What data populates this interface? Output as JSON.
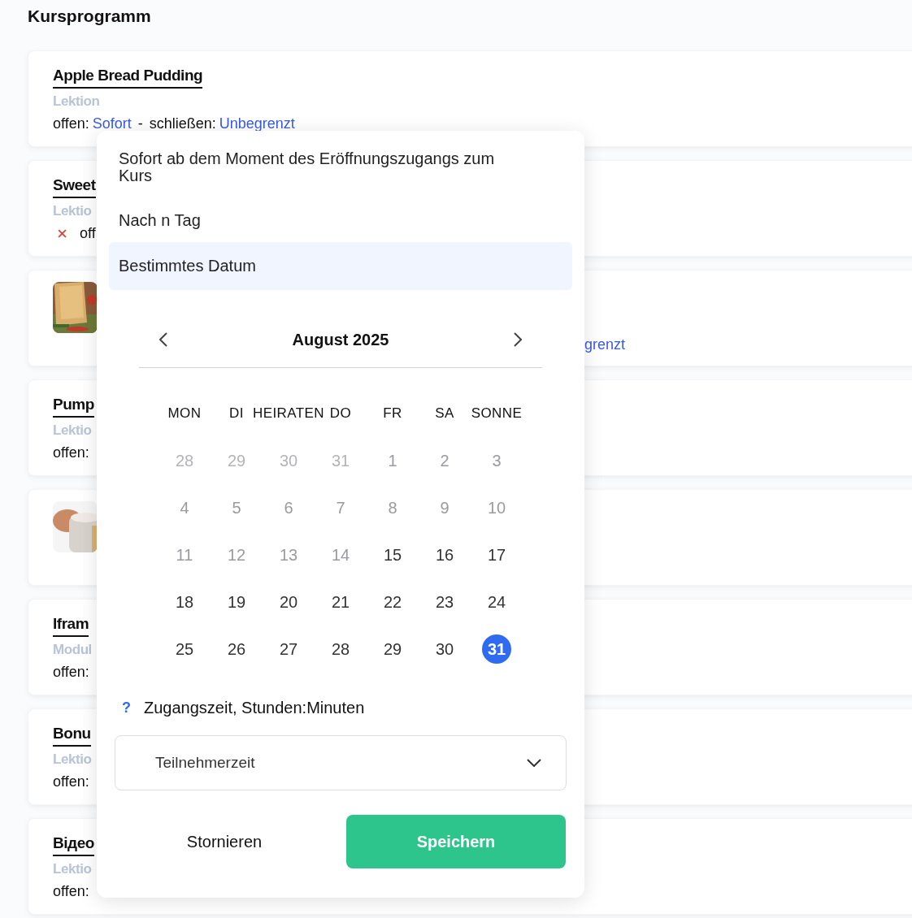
{
  "page": {
    "title": "Kursprogramm"
  },
  "cards": [
    {
      "kind": "text",
      "title": "Apple Bread Pudding",
      "subtitle": "Lektion",
      "open_label": "offen:",
      "open_value": "Sofort",
      "separator": "-",
      "close_label": "schließen:",
      "close_value": "Unbegrenzt"
    },
    {
      "kind": "blocked",
      "title": "Sweet",
      "subtitle": "Lektio",
      "open_label": "off"
    },
    {
      "kind": "picture",
      "trailing": "grenzt"
    },
    {
      "kind": "text",
      "title": "Pump",
      "subtitle": "Lektio",
      "open_label": "offen:"
    },
    {
      "kind": "picture"
    },
    {
      "kind": "text",
      "title": "Ifram",
      "subtitle": "Modul",
      "open_label": "offen:"
    },
    {
      "kind": "text",
      "title": "Bonu",
      "subtitle": "Lektio",
      "open_label": "offen:"
    },
    {
      "kind": "text",
      "title": "Відео",
      "subtitle": "Lektio",
      "open_label": "offen:"
    }
  ],
  "popup": {
    "options": [
      {
        "label": "Sofort ab dem Moment des Eröffnungszugangs zum Kurs",
        "selected": false
      },
      {
        "label": "Nach n Tag",
        "selected": false
      },
      {
        "label": "Bestimmtes Datum",
        "selected": true
      }
    ],
    "calendar": {
      "month": "August 2025",
      "weekdays": [
        "MON",
        "DI",
        "HEIRATEN",
        "DO",
        "FR",
        "SA",
        "SONNE"
      ],
      "days": [
        {
          "label": "28",
          "kind": "outside",
          "selected": false
        },
        {
          "label": "29",
          "kind": "outside",
          "selected": false
        },
        {
          "label": "30",
          "kind": "outside",
          "selected": false
        },
        {
          "label": "31",
          "kind": "outside",
          "selected": false
        },
        {
          "label": "1",
          "kind": "disabled",
          "selected": false
        },
        {
          "label": "2",
          "kind": "disabled",
          "selected": false
        },
        {
          "label": "3",
          "kind": "disabled",
          "selected": false
        },
        {
          "label": "4",
          "kind": "disabled",
          "selected": false
        },
        {
          "label": "5",
          "kind": "disabled",
          "selected": false
        },
        {
          "label": "6",
          "kind": "disabled",
          "selected": false
        },
        {
          "label": "7",
          "kind": "disabled",
          "selected": false
        },
        {
          "label": "8",
          "kind": "disabled",
          "selected": false
        },
        {
          "label": "9",
          "kind": "disabled",
          "selected": false
        },
        {
          "label": "10",
          "kind": "disabled",
          "selected": false
        },
        {
          "label": "11",
          "kind": "disabled",
          "selected": false
        },
        {
          "label": "12",
          "kind": "disabled",
          "selected": false
        },
        {
          "label": "13",
          "kind": "disabled",
          "selected": false
        },
        {
          "label": "14",
          "kind": "disabled",
          "selected": false
        },
        {
          "label": "15",
          "kind": "enabled",
          "selected": false
        },
        {
          "label": "16",
          "kind": "enabled",
          "selected": false
        },
        {
          "label": "17",
          "kind": "enabled",
          "selected": false
        },
        {
          "label": "18",
          "kind": "enabled",
          "selected": false
        },
        {
          "label": "19",
          "kind": "enabled",
          "selected": false
        },
        {
          "label": "20",
          "kind": "enabled",
          "selected": false
        },
        {
          "label": "21",
          "kind": "enabled",
          "selected": false
        },
        {
          "label": "22",
          "kind": "enabled",
          "selected": false
        },
        {
          "label": "23",
          "kind": "enabled",
          "selected": false
        },
        {
          "label": "24",
          "kind": "enabled",
          "selected": false
        },
        {
          "label": "25",
          "kind": "enabled",
          "selected": false
        },
        {
          "label": "26",
          "kind": "enabled",
          "selected": false
        },
        {
          "label": "27",
          "kind": "enabled",
          "selected": false
        },
        {
          "label": "28",
          "kind": "enabled",
          "selected": false
        },
        {
          "label": "29",
          "kind": "enabled",
          "selected": false
        },
        {
          "label": "30",
          "kind": "enabled",
          "selected": false
        },
        {
          "label": "31",
          "kind": "enabled",
          "selected": true
        }
      ]
    },
    "help_mark": "?",
    "time_label": "Zugangszeit, Stunden:Minuten",
    "time_select": {
      "value": "Teilnehmerzeit"
    },
    "buttons": {
      "cancel": "Stornieren",
      "save": "Speichern"
    }
  }
}
